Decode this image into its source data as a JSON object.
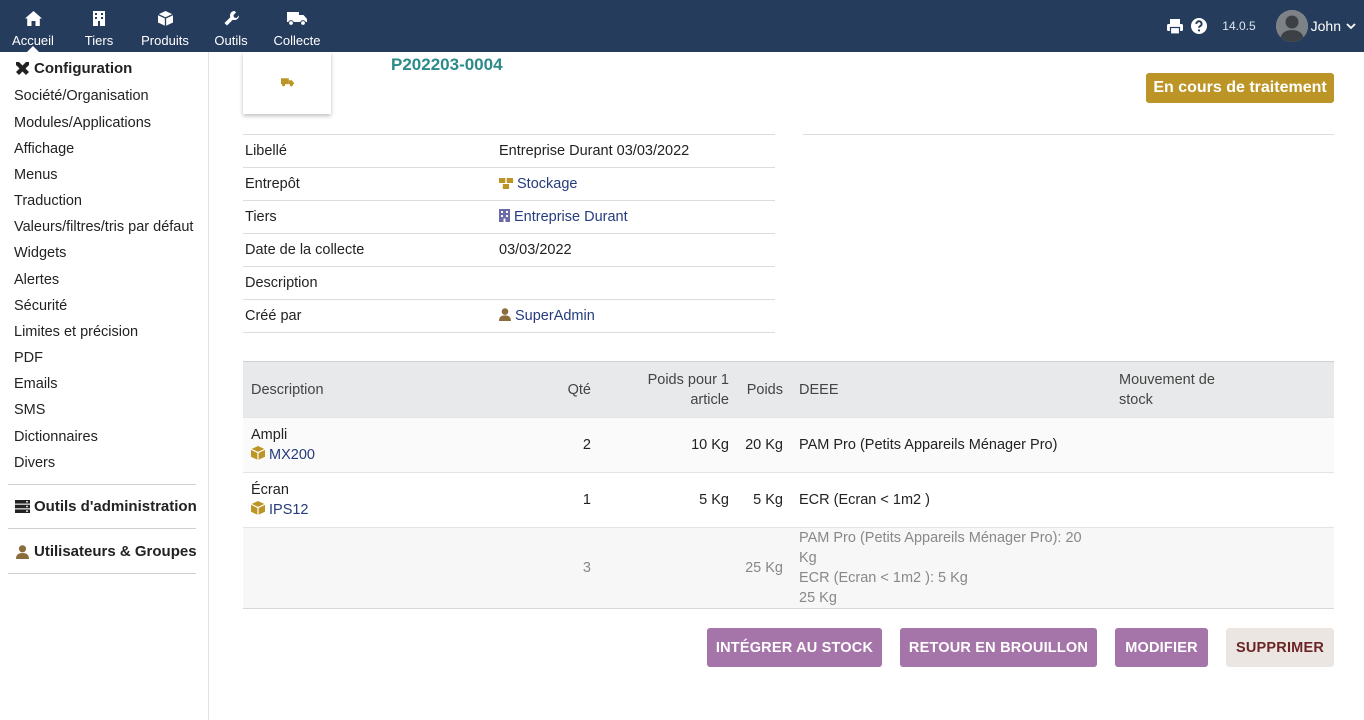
{
  "nav": {
    "items": [
      {
        "label": "Accueil",
        "icon": "home-icon"
      },
      {
        "label": "Tiers",
        "icon": "building-icon"
      },
      {
        "label": "Produits",
        "icon": "cube-icon"
      },
      {
        "label": "Outils",
        "icon": "wrench-icon"
      },
      {
        "label": "Collecte",
        "icon": "truck-icon"
      }
    ],
    "version": "14.0.5",
    "user_name": "John"
  },
  "sidebar": {
    "configuration": "Configuration",
    "items": [
      "Société/Organisation",
      "Modules/Applications",
      "Affichage",
      "Menus",
      "Traduction",
      "Valeurs/filtres/tris par défaut",
      "Widgets",
      "Alertes",
      "Sécurité",
      "Limites et précision",
      "PDF",
      "Emails",
      "SMS",
      "Dictionnaires",
      "Divers"
    ],
    "admin_tools": "Outils d'administration",
    "users_groups": "Utilisateurs & Groupes"
  },
  "record": {
    "ref": "P202203-0004",
    "status": "En cours de traitement"
  },
  "info": {
    "libelle_label": "Libellé",
    "libelle_value": "Entreprise Durant 03/03/2022",
    "entrepot_label": "Entrepôt",
    "entrepot_value": "Stockage",
    "tiers_label": "Tiers",
    "tiers_value": "Entreprise Durant",
    "date_label": "Date de la collecte",
    "date_value": "03/03/2022",
    "description_label": "Description",
    "description_value": "",
    "cree_label": "Créé par",
    "cree_value": "SuperAdmin"
  },
  "lines": {
    "headers": {
      "description": "Description",
      "qte": "Qté",
      "poids_unit_1": "Poids pour 1",
      "poids_unit_2": "article",
      "poids": "Poids",
      "deee": "DEEE",
      "mouvement_1": "Mouvement de",
      "mouvement_2": "stock"
    },
    "rows": [
      {
        "name": "Ampli",
        "product": "MX200",
        "qte": "2",
        "poids_unit": "10 Kg",
        "poids": "20 Kg",
        "deee": "PAM Pro (Petits Appareils Ménager Pro)"
      },
      {
        "name": "Écran",
        "product": "IPS12",
        "qte": "1",
        "poids_unit": "5 Kg",
        "poids": "5 Kg",
        "deee": "ECR (Ecran < 1m2 )"
      }
    ],
    "total": {
      "qte": "3",
      "poids": "25 Kg",
      "deee_line1": "PAM Pro (Petits Appareils Ménager Pro): 20 Kg",
      "deee_line2": "ECR (Ecran < 1m2 ): 5 Kg",
      "deee_line3": "25 Kg"
    }
  },
  "actions": {
    "integrate": "INTÉGRER AU STOCK",
    "draft": "RETOUR EN BROUILLON",
    "modify": "MODIFIER",
    "delete": "SUPPRIMER"
  },
  "colors": {
    "topbar": "#263c5c",
    "accent_teal": "#2b8a8a",
    "status": "#bc9526",
    "button_purple": "#a574a8",
    "link": "#263c7c"
  }
}
